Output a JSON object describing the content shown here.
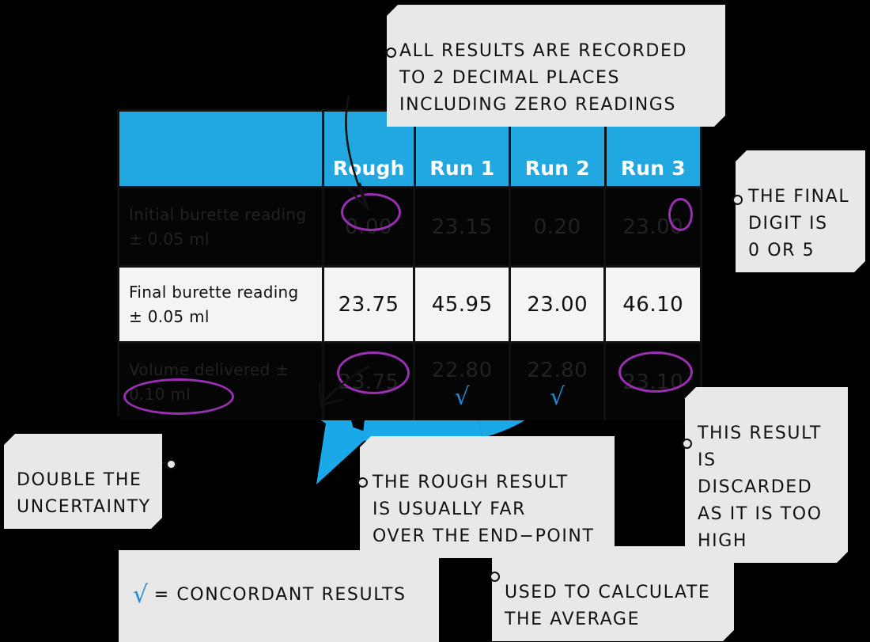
{
  "colors": {
    "header_blue": "#21A8E0",
    "arrow_blue": "#1BA8E8",
    "tick_blue": "#1E88D8",
    "ring_purple": "#9B2FB4",
    "callout_bg": "#E8E8E8",
    "dark_row_bg": "#050505",
    "light_row_bg": "#F4F4F4",
    "page_bg": "#000000"
  },
  "table": {
    "columns": [
      "",
      "Rough",
      "Run 1",
      "Run 2",
      "Run 3"
    ],
    "rows": [
      {
        "label": "Initial burette\nreading  ± 0.05 ml",
        "style": "dark",
        "values": [
          "0.00",
          "23.15",
          "0.20",
          "23.00"
        ],
        "ticks": [
          false,
          false,
          false,
          false
        ]
      },
      {
        "label": "Final burette\nreading ± 0.05 ml",
        "style": "light",
        "values": [
          "23.75",
          "45.95",
          "23.00",
          "46.10"
        ],
        "ticks": [
          false,
          false,
          false,
          false
        ]
      },
      {
        "label": "Volume delivered\n± 0.10 ml",
        "style": "dark",
        "values": [
          "23.75",
          "22.80",
          "22.80",
          "23.10"
        ],
        "ticks": [
          false,
          true,
          true,
          false
        ]
      }
    ]
  },
  "callouts": {
    "recorded": "ALL  RESULTS  ARE  RECORDED\nTO  2  DECIMAL  PLACES\nINCLUDING  ZERO  READINGS",
    "final_digit": "THE  FINAL\nDIGIT  IS\n0  OR  5",
    "double_uncertainty": "DOUBLE  THE\nUNCERTAINTY",
    "rough_result": "THE  ROUGH  RESULT\nIS  USUALLY  FAR\nOVER  THE  END−POINT",
    "discarded": "THIS  RESULT\nIS  DISCARDED\nAS  IT  IS  TOO\nHIGH",
    "used_average": "USED  TO  CALCULATE\nTHE  AVERAGE"
  },
  "legend": {
    "tick_glyph": "√",
    "text": "= CONCORDANT  RESULTS"
  }
}
